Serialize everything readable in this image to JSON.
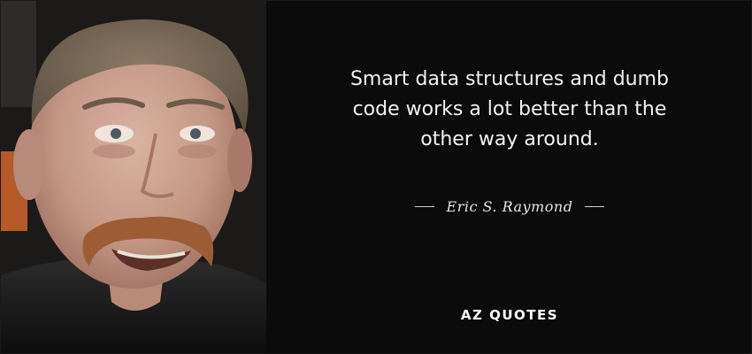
{
  "quote": {
    "text": "Smart data structures and dumb\ncode works a lot better than the\nother way around."
  },
  "author": {
    "name": "Eric S. Raymond"
  },
  "brand": {
    "logo_text": "AZ QUOTES"
  },
  "colors": {
    "background": "#0b0b0b",
    "text": "#f2f2f2",
    "author_text": "#e6e6e6",
    "border": "#1a1a1a"
  },
  "icons": {
    "portrait": "author-portrait-photo"
  }
}
